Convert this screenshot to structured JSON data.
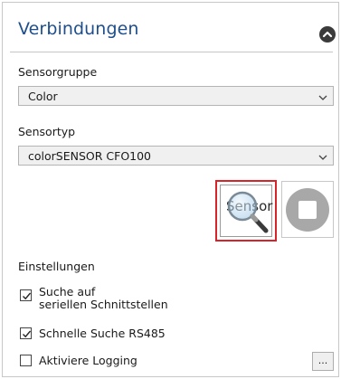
{
  "panel": {
    "title": "Verbindungen",
    "collapse_icon": "chevron-up-circle-icon"
  },
  "sensorgroup": {
    "label": "Sensorgruppe",
    "selected": "Color"
  },
  "sensortype": {
    "label": "Sensortyp",
    "selected": "colorSENSOR CFO100"
  },
  "actions": {
    "search_label": "Sensor",
    "search_icon": "magnifier-icon",
    "stop_icon": "stop-icon",
    "highlight_color": "#d9232a"
  },
  "settings": {
    "heading": "Einstellungen",
    "serial_search_line1": "Suche auf",
    "serial_search_line2": "seriellen Schnittstellen",
    "serial_search_checked": true,
    "fast_search_label": "Schnelle Suche RS485",
    "fast_search_checked": true,
    "logging_label": "Aktiviere Logging",
    "logging_checked": false,
    "more_label": "..."
  },
  "colors": {
    "title": "#1e4f8c"
  }
}
